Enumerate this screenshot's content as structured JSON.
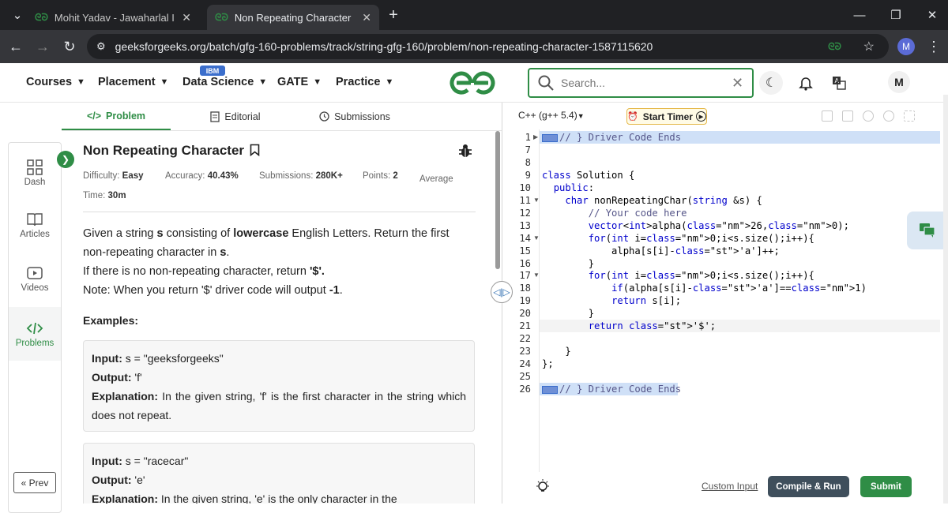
{
  "browser": {
    "tabs": [
      {
        "title": "Mohit Yadav - Jawaharlal Institu",
        "active": false
      },
      {
        "title": "Non Repeating Character | Prac",
        "active": true
      }
    ],
    "url": "geeksforgeeks.org/batch/gfg-160-problems/track/string-gfg-160/problem/non-repeating-character-1587115620",
    "profile_initial": "M"
  },
  "header": {
    "nav": [
      {
        "label": "Courses"
      },
      {
        "label": "Placement"
      },
      {
        "label": "Data Science"
      },
      {
        "label": "GATE"
      },
      {
        "label": "Practice"
      }
    ],
    "badge": "IBM",
    "search_placeholder": "Search...",
    "user_initial": "M"
  },
  "sidebar": {
    "items": [
      {
        "label": "Dash",
        "icon": "dashboard-icon"
      },
      {
        "label": "Articles",
        "icon": "book-icon"
      },
      {
        "label": "Videos",
        "icon": "video-icon"
      },
      {
        "label": "Problems",
        "icon": "code-icon",
        "active": true
      }
    ],
    "prev_label": "« Prev"
  },
  "subtabs": [
    {
      "label": "Problem",
      "icon": "code-icon",
      "active": true
    },
    {
      "label": "Editorial",
      "icon": "document-icon"
    },
    {
      "label": "Submissions",
      "icon": "clock-icon"
    }
  ],
  "problem": {
    "title": "Non Repeating Character",
    "difficulty_label": "Difficulty:",
    "difficulty": "Easy",
    "accuracy_label": "Accuracy:",
    "accuracy": "40.43%",
    "submissions_label": "Submissions:",
    "submissions": "280K+",
    "points_label": "Points:",
    "points": "2",
    "avg_time_label": "Average Time:",
    "avg_time": "30m",
    "desc_1": "Given a string ",
    "desc_s": "s",
    "desc_2": " consisting of ",
    "desc_lower": "lowercase",
    "desc_3": " English Letters. Return the first non-repeating character in ",
    "desc_s2": "s",
    "desc_4": ".",
    "desc_line2": "If there is no non-repeating character, return ",
    "desc_dollar": "'$'.",
    "desc_line3": "Note: When you return '$' driver code will output ",
    "desc_minus": "-1",
    "desc_dot": ".",
    "examples_heading": "Examples:",
    "examples": [
      {
        "input_label": "Input:",
        "input": "s = \"geeksforgeeks\"",
        "output_label": "Output:",
        "output": "'f'",
        "explanation_label": "Explanation:",
        "explanation": "In the given string, 'f' is the first character in the string which does not repeat."
      },
      {
        "input_label": "Input:",
        "input": "s = \"racecar\"",
        "output_label": "Output:",
        "output": "'e'",
        "explanation_label": "Explanation:",
        "explanation": "In the given string, 'e' is the only character in the"
      }
    ]
  },
  "editor": {
    "language": "C++ (g++ 5.4)",
    "timer_label": "Start Timer",
    "custom_input": "Custom Input",
    "compile_label": "Compile & Run",
    "submit_label": "Submit",
    "lines": [
      {
        "n": "1",
        "text": "// } Driver Code Ends"
      },
      {
        "n": "7",
        "text": ""
      },
      {
        "n": "8",
        "text": ""
      },
      {
        "n": "9",
        "text": "class Solution {"
      },
      {
        "n": "10",
        "text": "  public:"
      },
      {
        "n": "11",
        "text": "    char nonRepeatingChar(string &s) {"
      },
      {
        "n": "12",
        "text": "        // Your code here"
      },
      {
        "n": "13",
        "text": "        vector<int>alpha(26,0);"
      },
      {
        "n": "14",
        "text": "        for(int i=0;i<s.size();i++){"
      },
      {
        "n": "15",
        "text": "            alpha[s[i]-'a']++;"
      },
      {
        "n": "16",
        "text": "        }"
      },
      {
        "n": "17",
        "text": "        for(int i=0;i<s.size();i++){"
      },
      {
        "n": "18",
        "text": "            if(alpha[s[i]-'a']==1)"
      },
      {
        "n": "19",
        "text": "            return s[i];"
      },
      {
        "n": "20",
        "text": "        }"
      },
      {
        "n": "21",
        "text": "        return '$';"
      },
      {
        "n": "22",
        "text": ""
      },
      {
        "n": "23",
        "text": "    }"
      },
      {
        "n": "24",
        "text": "};"
      },
      {
        "n": "25",
        "text": ""
      },
      {
        "n": "26",
        "text": "// } Driver Code Ends"
      }
    ]
  }
}
